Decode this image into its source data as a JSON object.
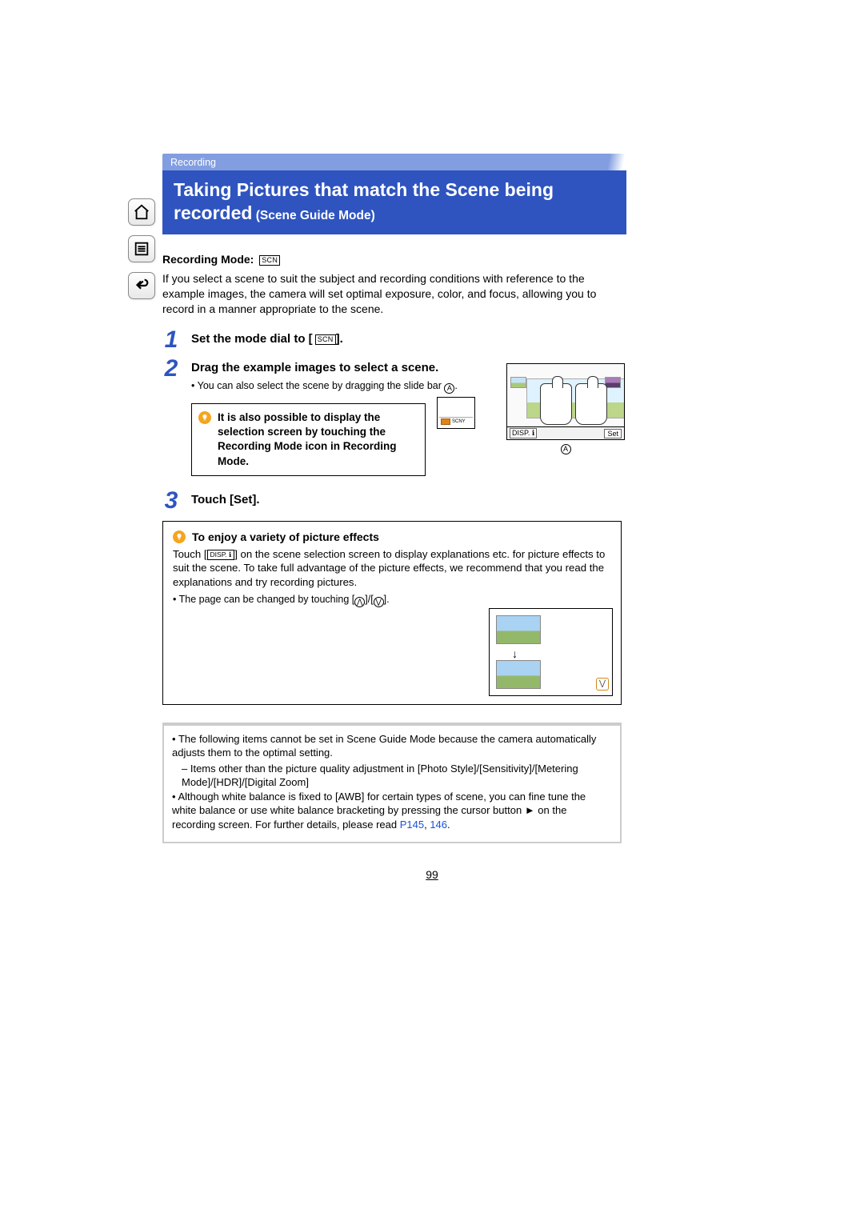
{
  "breadcrumb": "Recording",
  "title_line1": "Taking Pictures that match the Scene being",
  "title_line2_strong": "recorded",
  "title_line2_sub": " (Scene Guide Mode)",
  "recording_mode_label": "Recording Mode:",
  "scn_badge": "SCN",
  "intro": "If you select a scene to suit the subject and recording conditions with reference to the example images, the camera will set optimal exposure, color, and focus, allowing you to record in a manner appropriate to the scene.",
  "steps": {
    "s1_title_a": "Set the mode dial to [",
    "s1_title_b": "].",
    "s2_title": "Drag the example images to select a scene.",
    "s2_bullet": "You can also select the scene by dragging the slide bar ",
    "circle_a": "A",
    "s2_hint": "It is also possible to display the selection screen by touching the Recording Mode icon in Recording Mode.",
    "s3_title": "Touch [Set]."
  },
  "illus": {
    "disp_label": "DISP.",
    "set_label": "Set",
    "caption_a": "A"
  },
  "effects": {
    "title": "To enjoy a variety of picture effects",
    "text_a": "Touch [",
    "disp_chip": "DISP.",
    "text_b": "] on the scene selection screen to display explanations etc. for picture effects to suit the scene. To take full advantage of the picture effects, we recommend that you read the explanations and try recording pictures.",
    "page_change_a": "The page can be changed by touching [",
    "page_change_b": "]/[",
    "page_change_c": "].",
    "up": "⋀",
    "down": "⋁",
    "arrow": "↓"
  },
  "notes": {
    "n1": "The following items cannot be set in Scene Guide Mode because the camera automatically adjusts them to the optimal setting.",
    "n1_sub": "Items other than the picture quality adjustment in [Photo Style]/[Sensitivity]/[Metering Mode]/[HDR]/[Digital Zoom]",
    "n2_a": "Although white balance is fixed to [AWB] for certain types of scene, you can fine tune the white balance or use white balance bracketing by pressing the cursor button ► on the recording screen. For further details, please read ",
    "link1": "P145",
    "sep": ", ",
    "link2": "146",
    "period": "."
  },
  "page_number": "99"
}
